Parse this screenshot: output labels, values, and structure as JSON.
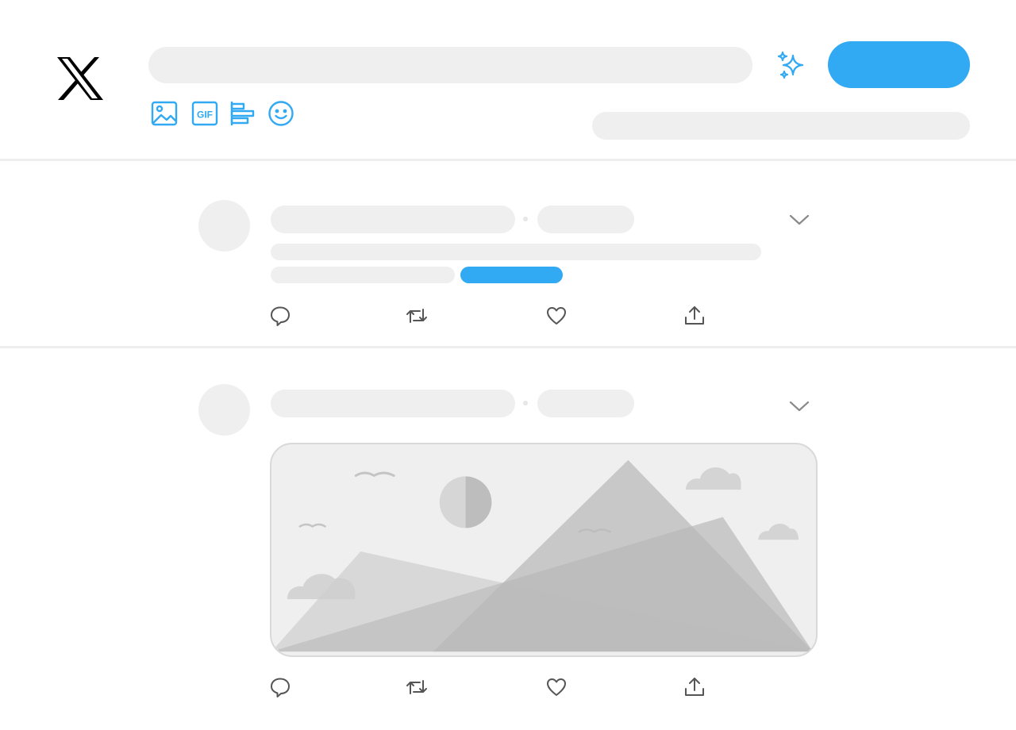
{
  "app": {
    "logo_icon": "x-logo-icon"
  },
  "composer": {
    "toolbar_icons": [
      "image-icon",
      "gif-icon",
      "poll-icon",
      "emoji-icon"
    ],
    "gif_label": "GIF",
    "sparkle_icon": "sparkle-icon",
    "accent_color": "#31a9f3"
  },
  "feed": {
    "posts": [
      {
        "actions": [
          "reply-icon",
          "repost-icon",
          "like-icon",
          "share-icon"
        ],
        "has_link": true,
        "has_media": false
      },
      {
        "actions": [
          "reply-icon",
          "repost-icon",
          "like-icon",
          "share-icon"
        ],
        "has_link": false,
        "has_media": true
      }
    ]
  }
}
